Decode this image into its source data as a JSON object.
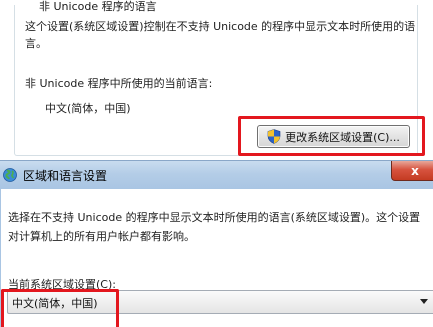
{
  "upper_dialog": {
    "group_title": "非 Unicode 程序的语言",
    "description": "这个设置(系统区域设置)控制在不支持 Unicode 的程序中显示文本时所使用的语言。",
    "current_lang_label": "非 Unicode 程序中所使用的当前语言:",
    "current_lang_value": "中文(简体，中国)",
    "change_button_label": "更改系统区域设置(C)..."
  },
  "region_dialog": {
    "title": "区域和语言设置",
    "close_symbol": "x",
    "description": "选择在不支持 Unicode 的程序中显示文本时所使用的语言(系统区域设置)。这个设置对计算机上的所有用户帐户都有影响。",
    "locale_label": "当前系统区域设置(C):",
    "locale_value": "中文(简体，中国)"
  },
  "colors": {
    "highlight": "#e3171e",
    "titlebar": "#b4cde7",
    "close_button": "#d7533f"
  },
  "icons": {
    "uac": "uac-shield-icon",
    "globe": "globe-icon",
    "dropdown": "chevron-down-icon"
  }
}
